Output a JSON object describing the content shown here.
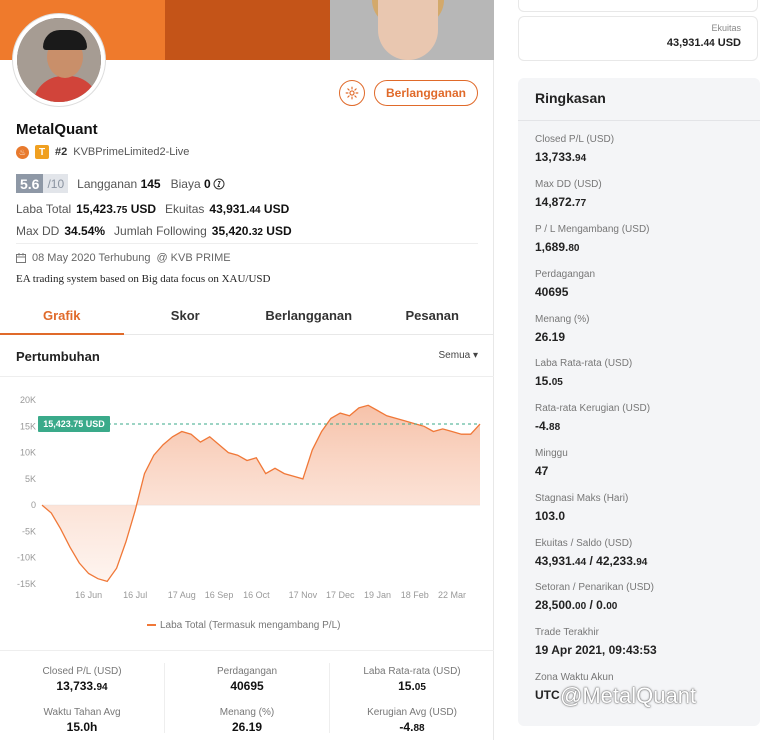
{
  "profile": {
    "name": "MetalQuant",
    "rank": "#2",
    "server": "KVBPrimeLimited2-Live",
    "score": "5.6",
    "score_max": "/10",
    "subscriptions_label": "Langganan",
    "subscriptions_value": "145",
    "fee_label": "Biaya",
    "fee_value": "0",
    "total_profit_label": "Laba Total",
    "total_profit_main": "15,423.",
    "total_profit_dec": "75",
    "total_profit_unit": "USD",
    "equity_label": "Ekuitas",
    "equity_main": "43,931.",
    "equity_dec": "44",
    "equity_unit": "USD",
    "maxdd_label": "Max DD",
    "maxdd_value": "34.54%",
    "following_label": "Jumlah Following",
    "following_main": "35,420.",
    "following_dec": "32",
    "following_unit": "USD",
    "connected_date": "08 May 2020 Terhubung",
    "broker": "@ KVB PRIME",
    "description": "EA trading system based on Big data focus on XAU/USD",
    "subscribe_button": "Berlangganan",
    "settings_icon": "gear-icon"
  },
  "tabs": [
    {
      "label": "Grafik",
      "active": true
    },
    {
      "label": "Skor",
      "active": false
    },
    {
      "label": "Berlangganan",
      "active": false
    },
    {
      "label": "Pesanan",
      "active": false
    }
  ],
  "growth": {
    "title": "Pertumbuhan",
    "filter": "Semua ▾"
  },
  "chart_data": {
    "type": "area",
    "title": "",
    "xlabel": "",
    "ylabel": "",
    "ylim": [
      -15000,
      20000
    ],
    "yticks": [
      "20K",
      "15K",
      "10K",
      "5K",
      "0",
      "-5K",
      "-10K",
      "-15K"
    ],
    "xticks": [
      "16 Jun",
      "16 Jul",
      "17 Aug",
      "16 Sep",
      "16 Oct",
      "17 Nov",
      "17 Dec",
      "19 Jan",
      "18 Feb",
      "22 Mar"
    ],
    "current_label": "15,423.75 USD",
    "current_value": 15423.75,
    "series": [
      {
        "name": "Laba Total (Termasuk mengambang P/L)",
        "color": "#f07838",
        "x": [
          "08 May",
          "16 May",
          "24 May",
          "01 Jun",
          "08 Jun",
          "16 Jun",
          "24 Jun",
          "01 Jul",
          "08 Jul",
          "12 Jul",
          "16 Jul",
          "20 Jul",
          "24 Jul",
          "01 Aug",
          "08 Aug",
          "17 Aug",
          "25 Aug",
          "01 Sep",
          "08 Sep",
          "16 Sep",
          "24 Sep",
          "01 Oct",
          "08 Oct",
          "16 Oct",
          "24 Oct",
          "01 Nov",
          "08 Nov",
          "12 Nov",
          "17 Nov",
          "24 Nov",
          "01 Dec",
          "08 Dec",
          "17 Dec",
          "24 Dec",
          "01 Jan",
          "10 Jan",
          "19 Jan",
          "28 Jan",
          "05 Feb",
          "12 Feb",
          "18 Feb",
          "25 Feb",
          "05 Mar",
          "12 Mar",
          "22 Mar",
          "01 Apr",
          "10 Apr",
          "19 Apr"
        ],
        "values": [
          0,
          -1500,
          -4500,
          -8000,
          -11000,
          -13000,
          -14000,
          -14500,
          -12000,
          -7000,
          -1000,
          6000,
          9500,
          11500,
          13000,
          14000,
          13500,
          12000,
          13000,
          11500,
          10000,
          9500,
          8500,
          9000,
          6000,
          7000,
          6000,
          5500,
          5000,
          10500,
          14000,
          16500,
          17500,
          17000,
          18500,
          19000,
          18000,
          17000,
          16500,
          16000,
          15500,
          15000,
          14000,
          14500,
          14000,
          13500,
          13500,
          15423.75
        ]
      }
    ],
    "legend": "bottom",
    "grid": false
  },
  "stats": [
    {
      "label": "Closed P/L (USD)",
      "main": "13,733.",
      "dec": "94",
      "green": true
    },
    {
      "label": "Perdagangan",
      "main": "40695",
      "dec": "",
      "green": false
    },
    {
      "label": "Laba Rata-rata (USD)",
      "main": "15.",
      "dec": "05",
      "green": false
    },
    {
      "label": "Waktu Tahan Avg",
      "main": "15.0h",
      "dec": "",
      "green": false
    },
    {
      "label": "Menang (%)",
      "main": "26.19",
      "dec": "",
      "green": false
    },
    {
      "label": "Kerugian Avg (USD)",
      "main": "-4.",
      "dec": "88",
      "green": false
    }
  ],
  "equity_card": {
    "label": "Ekuitas",
    "main": "43,931.",
    "dec": "44",
    "unit": "USD"
  },
  "summary": {
    "title": "Ringkasan",
    "items": [
      {
        "label": "Closed P/L (USD)",
        "main": "13,733.",
        "dec": "94",
        "green": true
      },
      {
        "label": "Max DD (USD)",
        "main": "14,872.",
        "dec": "77",
        "green": false
      },
      {
        "label": "P / L Mengambang (USD)",
        "main": "1,689.",
        "dec": "80",
        "green": true
      },
      {
        "label": "Perdagangan",
        "main": "40695",
        "dec": "",
        "green": false
      },
      {
        "label": "Menang (%)",
        "main": "26.19",
        "dec": "",
        "green": false
      },
      {
        "label": "Laba Rata-rata (USD)",
        "main": "15.",
        "dec": "05",
        "green": false
      },
      {
        "label": "Rata-rata Kerugian (USD)",
        "main": "-4.",
        "dec": "88",
        "green": false
      },
      {
        "label": "Minggu",
        "main": "47",
        "dec": "",
        "green": false
      },
      {
        "label": "Stagnasi Maks (Hari)",
        "main": "103.0",
        "dec": "",
        "green": false
      },
      {
        "label": "Ekuitas / Saldo (USD)",
        "main": "43,931.",
        "dec": "44",
        "main2": " / 42,233.",
        "dec2": "94",
        "green": false
      },
      {
        "label": "Setoran / Penarikan (USD)",
        "main": "28,500.",
        "dec": "00",
        "main2": " / 0.",
        "dec2": "00",
        "green": false
      },
      {
        "label": "Trade Terakhir",
        "main": "19 Apr 2021, 09:43:53",
        "dec": "",
        "green": false
      },
      {
        "label": "Zona Waktu Akun",
        "main": "UTC",
        "dec": "",
        "green": false
      }
    ]
  },
  "watermark": "@MetalQuant"
}
